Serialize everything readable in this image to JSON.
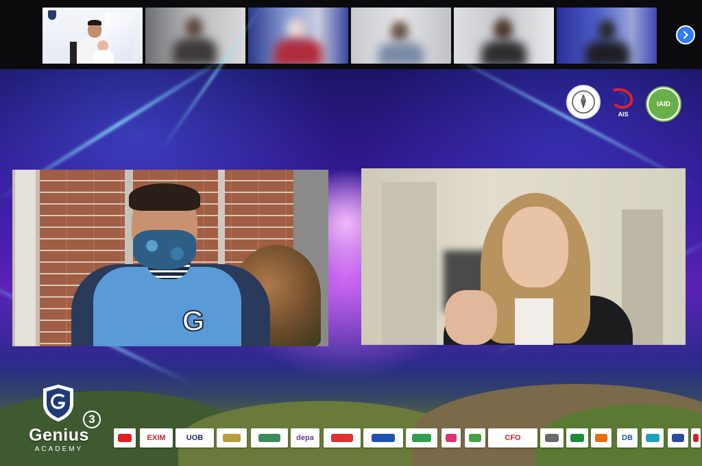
{
  "participants": {
    "next_label": "›"
  },
  "org_logos": {
    "logo2_text": "AIS",
    "logo3_text": "IAID"
  },
  "speakers": {
    "left_shirt_letter": "G"
  },
  "brand": {
    "name": "Genius",
    "sub": "ACADEMY",
    "number": "3"
  },
  "sponsors": [
    {
      "label": "",
      "color": "#e02020"
    },
    {
      "label": "EXIM",
      "color": "#d11f2a"
    },
    {
      "label": "UOB",
      "color": "#1a2a6c"
    },
    {
      "label": "",
      "color": "#b89b3a"
    },
    {
      "label": "",
      "color": "#3a8a5a"
    },
    {
      "label": "depa",
      "color": "#6a3a9a"
    },
    {
      "label": "",
      "color": "#e03030"
    },
    {
      "label": "",
      "color": "#2050b0"
    },
    {
      "label": "",
      "color": "#30a050"
    },
    {
      "label": "",
      "color": "#e03070"
    },
    {
      "label": "",
      "color": "#4aa040"
    },
    {
      "label": "CFO",
      "color": "#d02020"
    },
    {
      "label": "",
      "color": "#6a6a6a"
    },
    {
      "label": "",
      "color": "#1f8a3a"
    },
    {
      "label": "",
      "color": "#e07010"
    },
    {
      "label": "DB",
      "color": "#1a5ab0"
    },
    {
      "label": "",
      "color": "#20a0c0"
    },
    {
      "label": "",
      "color": "#2a4a9a"
    },
    {
      "label": "",
      "color": "#d02030"
    }
  ]
}
